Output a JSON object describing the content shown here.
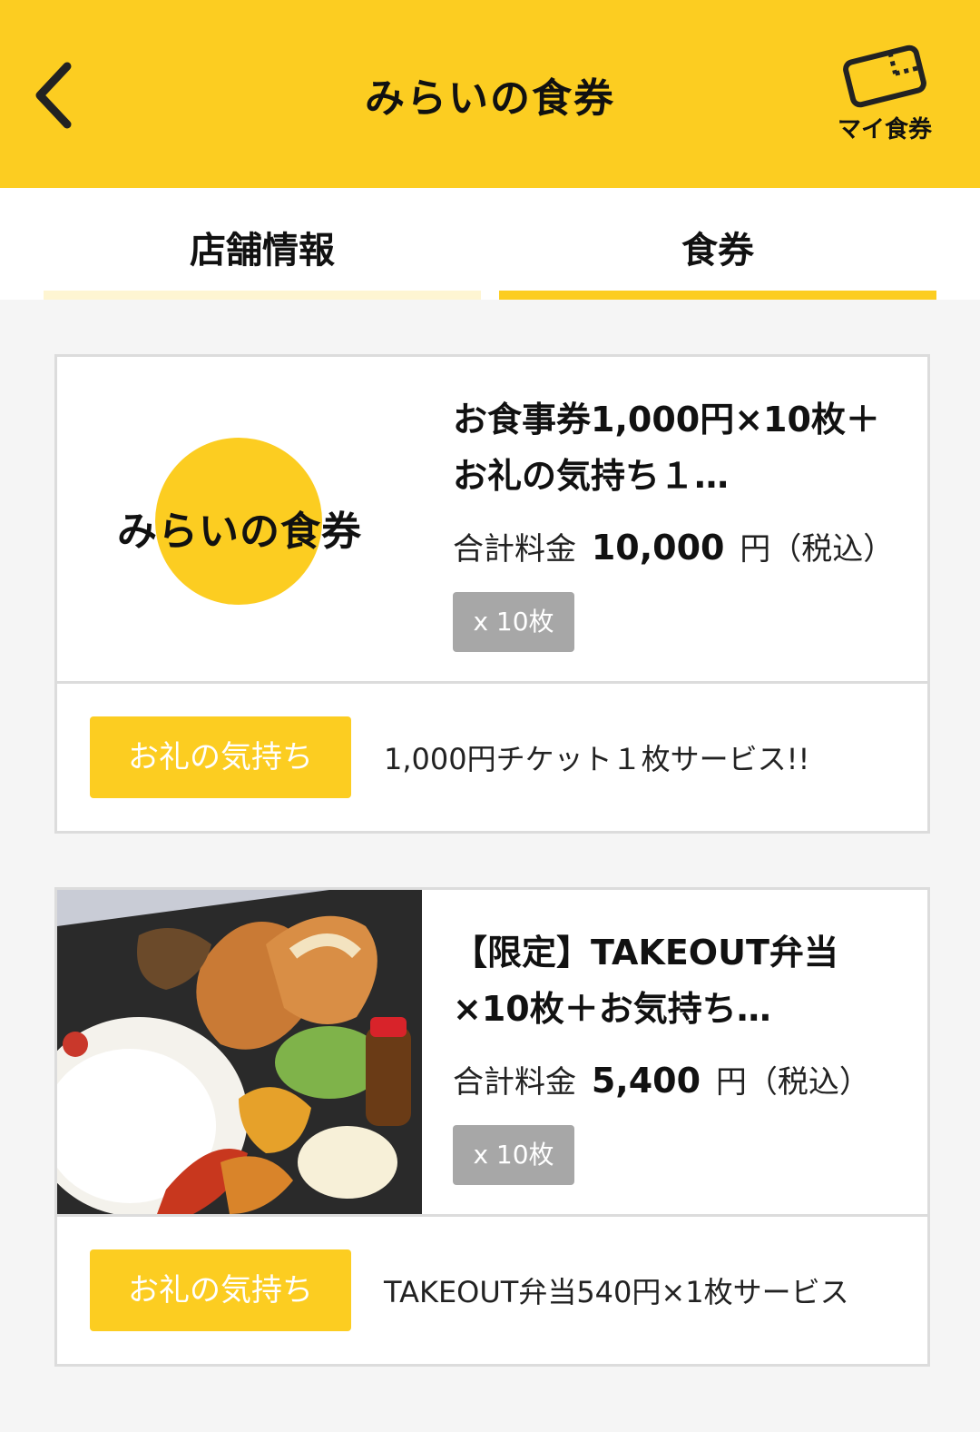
{
  "header": {
    "title": "みらいの食券",
    "my_ticket_label": "マイ食券",
    "accent_color": "#fccd21"
  },
  "tabs": [
    {
      "label": "店舗情報",
      "active": false
    },
    {
      "label": "食券",
      "active": true
    }
  ],
  "tickets": [
    {
      "title": "お食事券1,000円×10枚＋\nお礼の気持ち１…",
      "image_text": "みらいの食券",
      "price_label": "合計料金",
      "price": "10,000",
      "currency": "円",
      "tax_note": "（税込）",
      "quantity": "x 10枚",
      "bonus_label": "お礼の気持ち",
      "bonus_text": "1,000円チケット１枚サービス!!"
    },
    {
      "title": "【限定】TAKEOUT弁当\n×10枚＋お気持ち…",
      "price_label": "合計料金",
      "price": "5,400",
      "currency": "円",
      "tax_note": "（税込）",
      "quantity": "x 10枚",
      "bonus_label": "お礼の気持ち",
      "bonus_text": "TAKEOUT弁当540円×1枚サービス"
    }
  ]
}
